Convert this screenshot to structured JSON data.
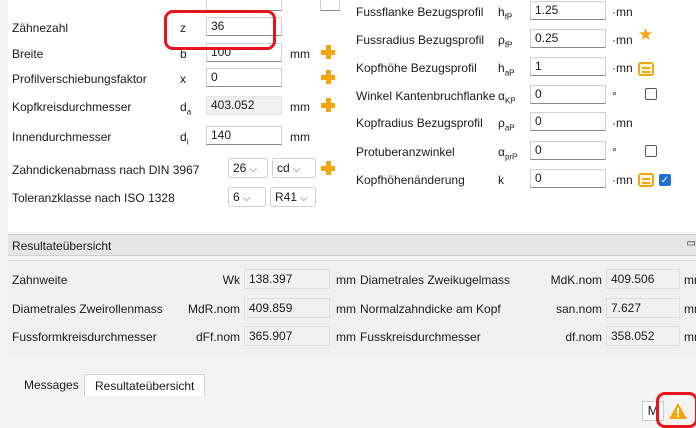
{
  "left_params": [
    {
      "label": "Zähnezahl",
      "symbol": "z",
      "sub": "",
      "value": "36",
      "unit": "",
      "readonly": false
    },
    {
      "label": "Breite",
      "symbol": "b",
      "sub": "",
      "value": "100",
      "unit": "mm",
      "readonly": false
    },
    {
      "label": "Profilverschiebungsfaktor",
      "symbol": "x",
      "sub": "",
      "value": "0",
      "unit": "",
      "readonly": false
    },
    {
      "label": "Kopfkreisdurchmesser",
      "symbol": "d",
      "sub": "a",
      "value": "403.052",
      "unit": "mm",
      "readonly": true
    },
    {
      "label": "Innendurchmesser",
      "symbol": "d",
      "sub": "i",
      "value": "140",
      "unit": "mm",
      "readonly": false
    }
  ],
  "dickenabmass": {
    "label": "Zahndickenabmass nach DIN 3967",
    "select1": "26",
    "select2": "cd"
  },
  "toleranz": {
    "label": "Toleranzklasse nach ISO 1328",
    "select1": "6",
    "select2": "R41"
  },
  "right_params": [
    {
      "label": "Fussflanke Bezugsprofil",
      "symbol": "h",
      "sub": "fP",
      "value": "1.25",
      "unit": "·mn"
    },
    {
      "label": "Fussradius Bezugsprofil",
      "symbol": "ρ",
      "sub": "fP",
      "value": "0.25",
      "unit": "·mn"
    },
    {
      "label": "Kopfhöhe Bezugsprofil",
      "symbol": "h",
      "sub": "aP",
      "value": "1",
      "unit": "·mn"
    },
    {
      "label": "Winkel Kantenbruchflanke",
      "symbol": "α",
      "sub": "KP",
      "value": "0",
      "unit": "°"
    },
    {
      "label": "Kopfradius Bezugsprofil",
      "symbol": "ρ",
      "sub": "aP",
      "value": "0",
      "unit": "·mn"
    },
    {
      "label": "Protuberanzwinkel",
      "symbol": "α",
      "sub": "prP",
      "value": "0",
      "unit": "°"
    },
    {
      "label": "Kopfhöhenänderung",
      "symbol": "k",
      "sub": "",
      "value": "0",
      "unit": "·mn"
    }
  ],
  "results": {
    "header": "Resultateübersicht",
    "rows": [
      {
        "left_label": "Zahnweite",
        "left_sym": "Wk",
        "left_val": "138.397",
        "left_unit": "mm",
        "right_label": "Diametrales Zweikugelmass",
        "right_sym": "MdK.nom",
        "right_val": "409.506",
        "right_unit": "mm"
      },
      {
        "left_label": "Diametrales Zweirollenmass",
        "left_sym": "MdR.nom",
        "left_val": "409.859",
        "left_unit": "mm",
        "right_label": "Normalzahndicke am Kopf",
        "right_sym": "san.nom",
        "right_val": "7.627",
        "right_unit": "mm"
      },
      {
        "left_label": "Fussformkreisdurchmesser",
        "left_sym": "dFf.nom",
        "left_val": "365.907",
        "left_unit": "mm",
        "right_label": "Fusskreisdurchmesser",
        "right_sym": "df.nom",
        "right_val": "358.052",
        "right_unit": "mm"
      }
    ]
  },
  "tabs": [
    "Messages",
    "Resultateübersicht"
  ],
  "status_m": "M",
  "colors": {
    "accent": "#f3a60d",
    "highlight": "#e8141c",
    "checkbox": "#1f6fd1"
  }
}
